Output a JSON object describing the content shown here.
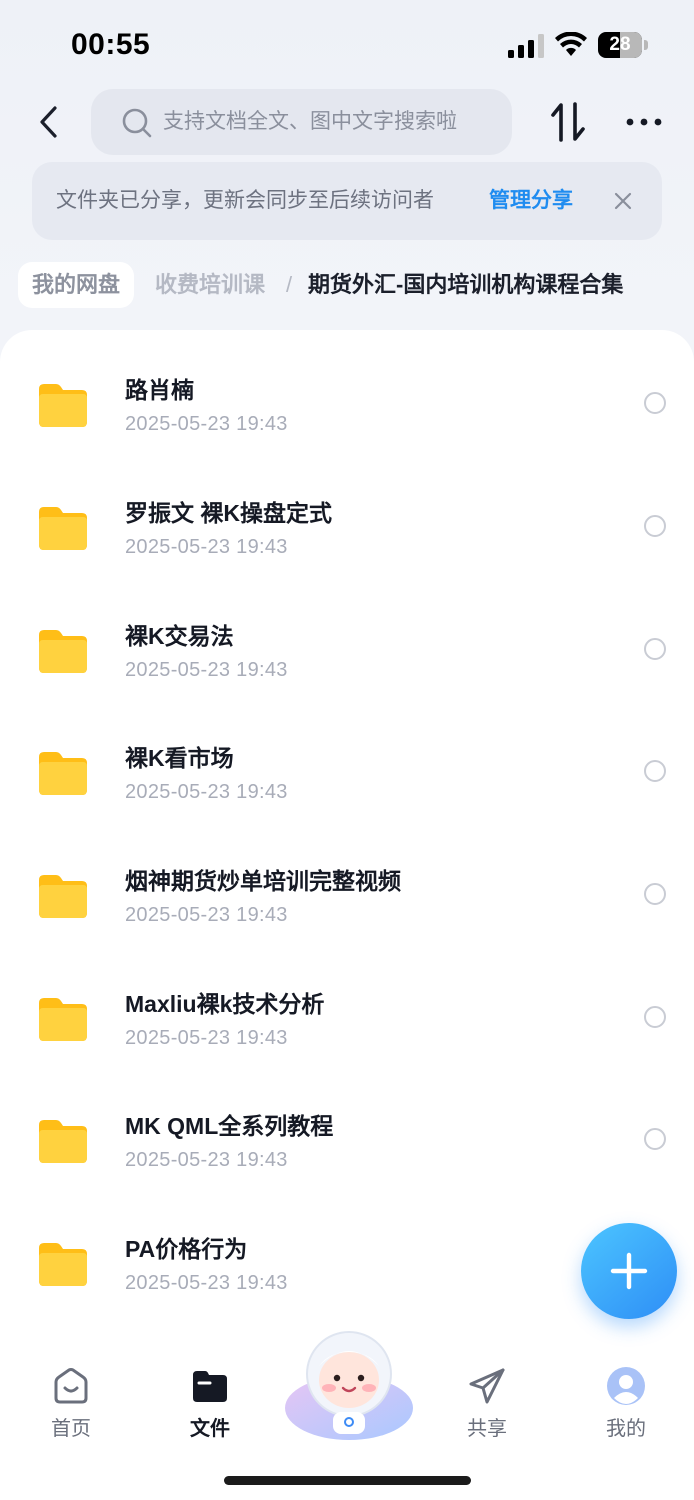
{
  "status_bar": {
    "time": "00:55",
    "battery": "28"
  },
  "search": {
    "placeholder": "支持文档全文、图中文字搜索啦"
  },
  "share_banner": {
    "text": "文件夹已分享，更新会同步至后续访问者",
    "action": "管理分享"
  },
  "breadcrumb": {
    "root": "我的网盘",
    "middle": "收费培训课",
    "separator": "/",
    "current": "期货外汇-国内培训机构课程合集"
  },
  "files": [
    {
      "name": "路肖楠",
      "date": "2025-05-23 19:43"
    },
    {
      "name": "罗振文 裸K操盘定式",
      "date": "2025-05-23 19:43"
    },
    {
      "name": "裸K交易法",
      "date": "2025-05-23 19:43"
    },
    {
      "name": "裸K看市场",
      "date": "2025-05-23 19:43"
    },
    {
      "name": "烟神期货炒单培训完整视频",
      "date": "2025-05-23 19:43"
    },
    {
      "name": "Maxliu裸k技术分析",
      "date": "2025-05-23 19:43"
    },
    {
      "name": "MK QML全系列教程",
      "date": "2025-05-23 19:43"
    },
    {
      "name": "PA价格行为",
      "date": "2025-05-23 19:43"
    }
  ],
  "tabs": [
    {
      "label": "首页",
      "icon": "home-icon"
    },
    {
      "label": "文件",
      "icon": "folder-icon",
      "active": true
    },
    {
      "label": "共享",
      "icon": "send-icon"
    },
    {
      "label": "我的",
      "icon": "avatar-icon"
    }
  ],
  "colors": {
    "accent": "#1f8cf0",
    "folder": "#ffc21f",
    "fab": "#2e8ef6"
  }
}
